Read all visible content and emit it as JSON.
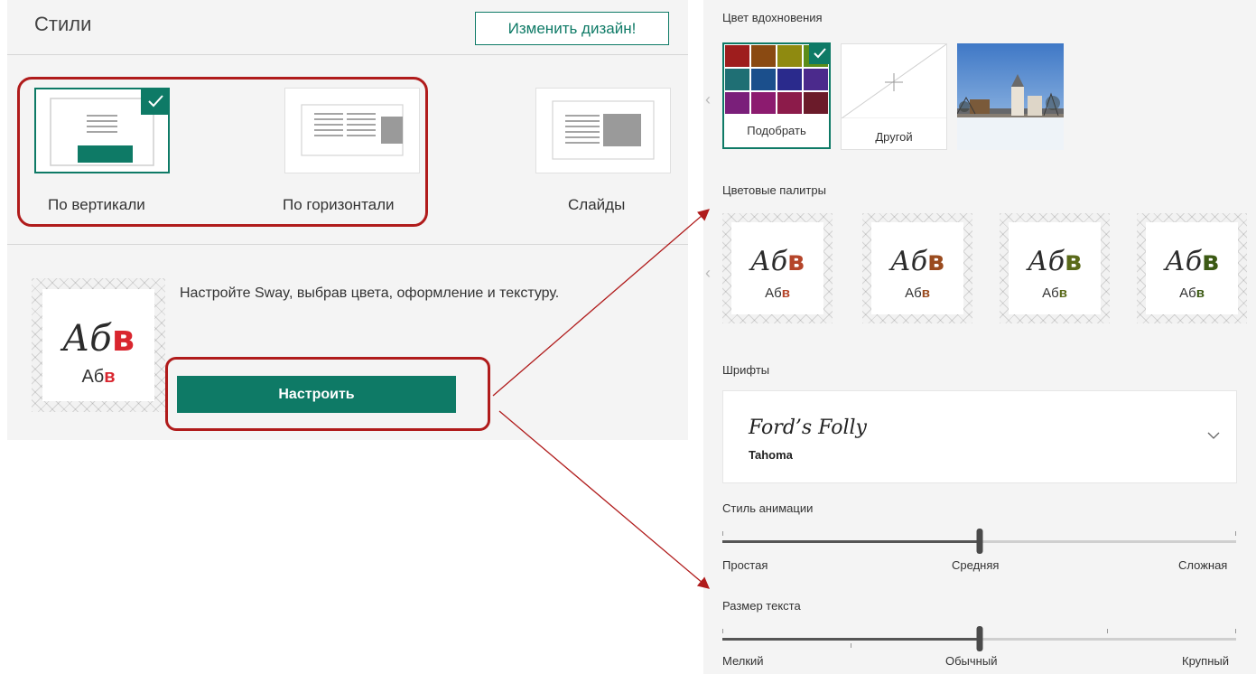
{
  "left": {
    "title": "Стили",
    "change_design": "Изменить дизайн!",
    "layouts": [
      {
        "label": "По вертикали",
        "selected": true
      },
      {
        "label": "По горизонтали",
        "selected": false
      },
      {
        "label": "Слайды",
        "selected": false
      }
    ],
    "preview": {
      "big": "Аб",
      "big_accent": "в",
      "small": "Аб",
      "small_accent": "в"
    },
    "customize_text": "Настройте Sway, выбрав цвета, оформление и текстуру.",
    "customize_button": "Настроить"
  },
  "right": {
    "inspiration_label": "Цвет вдохновения",
    "inspiration_pick": "Подобрать",
    "inspiration_other": "Другой",
    "palette_colors": [
      "#9e1d1d",
      "#8a4a12",
      "#8f8a10",
      "#5c8d1a",
      "#1f6f74",
      "#1b4f8c",
      "#2a2a8c",
      "#4b2a8c",
      "#7a1f7a",
      "#8c1b6f",
      "#8c1b4a",
      "#6b1b2a"
    ],
    "palettes_label": "Цветовые палитры",
    "palettes": [
      {
        "big": "Аб",
        "big_accent": "в",
        "small": "Аб",
        "small_accent": "в",
        "accent": "#b5452a"
      },
      {
        "big": "Аб",
        "big_accent": "в",
        "small": "Аб",
        "small_accent": "в",
        "accent": "#9a4b1f"
      },
      {
        "big": "Аб",
        "big_accent": "в",
        "small": "Аб",
        "small_accent": "в",
        "accent": "#5a6a1a"
      },
      {
        "big": "Аб",
        "big_accent": "в",
        "small": "Аб",
        "small_accent": "в",
        "accent": "#3c5a14"
      }
    ],
    "fonts_label": "Шрифты",
    "font_primary": "Ford’s Folly",
    "font_secondary": "Tahoma",
    "animation": {
      "label": "Стиль анимации",
      "min": "Простая",
      "mid": "Средняя",
      "max": "Сложная",
      "value_fraction": 0.5
    },
    "text_size": {
      "label": "Размер текста",
      "min": "Мелкий",
      "mid": "Обычный",
      "max": "Крупный",
      "value_fraction": 0.5
    }
  },
  "colors": {
    "accent": "#0e7a66",
    "highlight": "#b01b1b",
    "preview_accent": "#d9262f"
  }
}
